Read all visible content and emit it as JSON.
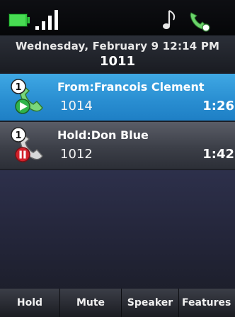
{
  "status_bar": {
    "icons": [
      "battery-icon",
      "signal-icon",
      "music-note-icon",
      "phone-handset-icon"
    ]
  },
  "header": {
    "date_time": "Wednesday, February 9 12:14 PM",
    "line": "1011"
  },
  "calls": [
    {
      "state": "active",
      "badge": "1",
      "title": "From:Francois Clement",
      "number": "1014",
      "duration": "1:26",
      "color": "#2a8fd2"
    },
    {
      "state": "held",
      "badge": "1",
      "title": "Hold:Don Blue",
      "number": "1012",
      "duration": "1:42",
      "color": "#3c3f48"
    }
  ],
  "softkeys": [
    "Hold",
    "Mute",
    "Speaker",
    "Features"
  ],
  "colors": {
    "battery": "#3fd24a",
    "active_row": "#2a8fd2",
    "play_badge": "#2fb34a",
    "hold_badge": "#d2212b"
  }
}
